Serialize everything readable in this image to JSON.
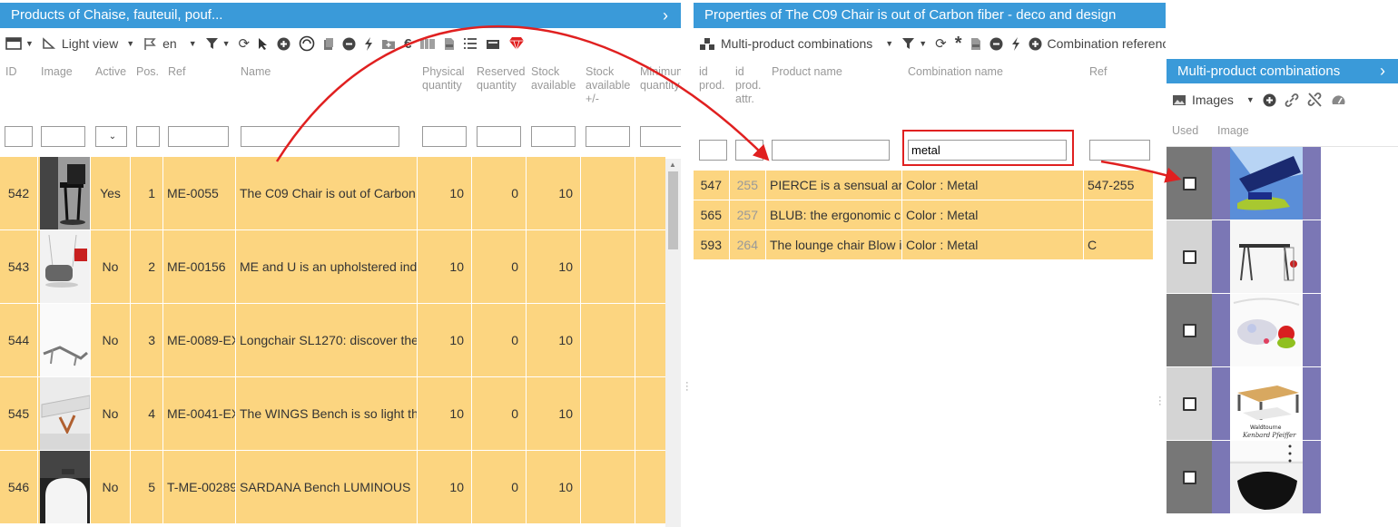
{
  "products_panel": {
    "title": "Products of Chaise, fauteuil, pouf...",
    "toolbar": {
      "view_label": "Light view",
      "lang_label": "en"
    },
    "columns": [
      "ID",
      "Image",
      "Active",
      "Pos.",
      "Ref",
      "Name",
      "Physical quantity",
      "Reserved quantity",
      "Stock available",
      "Stock available +/-",
      "Minimum quantity"
    ],
    "rows": [
      {
        "id": "542",
        "active": "Yes",
        "pos": "1",
        "ref": "ME-0055",
        "name": "The C09 Chair is out of Carbon",
        "physical": "10",
        "reserved": "0",
        "stock": "10"
      },
      {
        "id": "543",
        "active": "No",
        "pos": "2",
        "ref": "ME-00156",
        "name": "ME and U is an upholstered ind",
        "physical": "10",
        "reserved": "0",
        "stock": "10"
      },
      {
        "id": "544",
        "active": "No",
        "pos": "3",
        "ref": "ME-0089-EX",
        "name": "Longchair SL1270: discover the",
        "physical": "10",
        "reserved": "0",
        "stock": "10"
      },
      {
        "id": "545",
        "active": "No",
        "pos": "4",
        "ref": "ME-0041-EX",
        "name": "The WINGS Bench is so light th",
        "physical": "10",
        "reserved": "0",
        "stock": "10"
      },
      {
        "id": "546",
        "active": "No",
        "pos": "5",
        "ref": "T-ME-00289",
        "name": "SARDANA Bench LUMINOUS",
        "physical": "10",
        "reserved": "0",
        "stock": "10"
      }
    ]
  },
  "properties_panel": {
    "title": "Properties of The C09 Chair is out of Carbon fiber - deco and design",
    "toolbar": {
      "combinations_label": "Multi-product combinations",
      "references_label": "Combination references"
    },
    "columns": [
      "id prod.",
      "id prod. attr.",
      "Product name",
      "Combination name",
      "Ref"
    ],
    "filter_value": "metal",
    "rows": [
      {
        "id_prod": "547",
        "id_attr": "255",
        "product_name": "PIERCE is a sensual ar",
        "combination": "Color : Metal",
        "ref": "547-255"
      },
      {
        "id_prod": "565",
        "id_attr": "257",
        "product_name": "BLUB: the ergonomic c",
        "combination": "Color : Metal",
        "ref": ""
      },
      {
        "id_prod": "593",
        "id_attr": "264",
        "product_name": "The lounge chair Blow i",
        "combination": "Color : Metal",
        "ref": "C"
      }
    ]
  },
  "combinations_panel": {
    "title": "Multi-product combinations",
    "toolbar": {
      "images_label": "Images"
    },
    "columns": [
      "Used",
      "Image"
    ],
    "thumb_text": "Waldtourne\nKenbard Pfeiffer"
  }
}
